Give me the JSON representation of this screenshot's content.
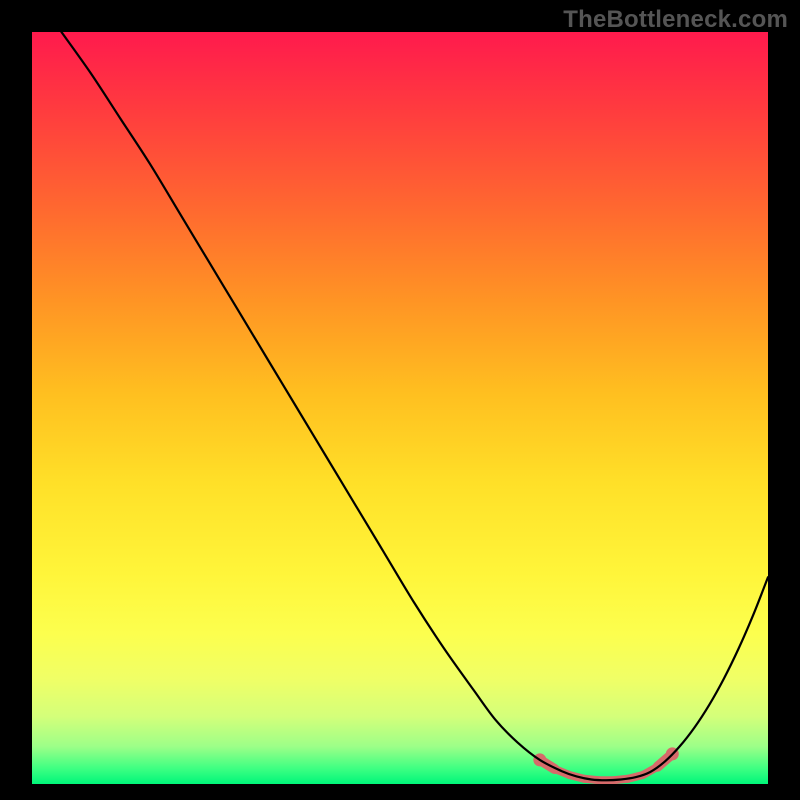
{
  "watermark": "TheBottleneck.com",
  "chart_data": {
    "type": "line",
    "title": "",
    "xlabel": "",
    "ylabel": "",
    "xlim": [
      0,
      100
    ],
    "ylim": [
      0,
      100
    ],
    "grid": false,
    "legend": false,
    "series": [
      {
        "name": "bottleneck-curve",
        "x": [
          4,
          8,
          12,
          16,
          20,
          24,
          28,
          32,
          36,
          40,
          44,
          48,
          52,
          56,
          60,
          63,
          66,
          69,
          72,
          74,
          76,
          78,
          80,
          82,
          84,
          86,
          88,
          90,
          92,
          94,
          96,
          98,
          100
        ],
        "values": [
          100,
          94.5,
          88.5,
          82.5,
          76,
          69.5,
          63,
          56.5,
          50,
          43.5,
          37,
          30.5,
          24,
          18,
          12.5,
          8.5,
          5.5,
          3.2,
          1.7,
          1.0,
          0.6,
          0.5,
          0.6,
          0.9,
          1.6,
          3.0,
          5.0,
          7.5,
          10.5,
          14.0,
          18.0,
          22.5,
          27.5
        ]
      }
    ],
    "markers": {
      "name": "bottom-band",
      "color": "#d66a6a",
      "points": [
        {
          "x": 69,
          "y": 3.2
        },
        {
          "x": 71,
          "y": 2.0
        },
        {
          "x": 73,
          "y": 1.2
        },
        {
          "x": 75,
          "y": 0.7
        },
        {
          "x": 77,
          "y": 0.5
        },
        {
          "x": 79,
          "y": 0.5
        },
        {
          "x": 81,
          "y": 0.7
        },
        {
          "x": 83,
          "y": 1.2
        },
        {
          "x": 85,
          "y": 2.3
        },
        {
          "x": 87,
          "y": 4.0
        }
      ]
    }
  }
}
